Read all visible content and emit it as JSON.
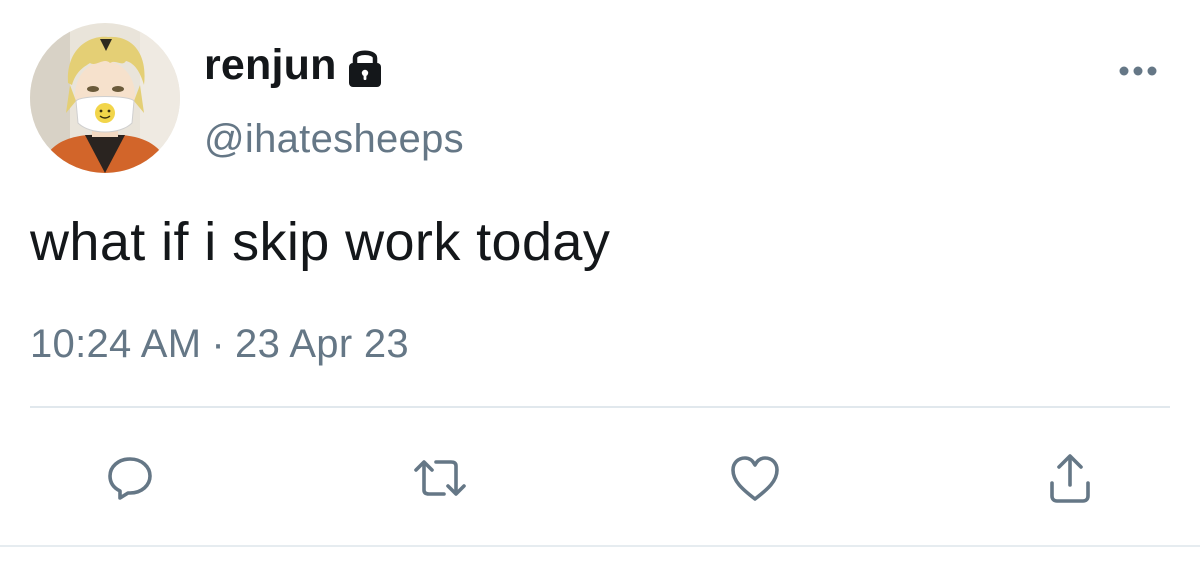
{
  "user": {
    "display_name": "renjun",
    "handle": "@ihatesheeps",
    "protected_icon": "lock-icon",
    "avatar": "avatar-image"
  },
  "tweet": {
    "text": "what if i skip work today",
    "time": "10:24 AM",
    "separator": "·",
    "date": "23 Apr 23"
  },
  "menu": {
    "icon": "more-options-icon"
  },
  "actions": [
    {
      "icon": "reply-icon"
    },
    {
      "icon": "retweet-icon"
    },
    {
      "icon": "like-icon"
    },
    {
      "icon": "share-icon"
    }
  ],
  "colors": {
    "text_primary": "#14171a",
    "text_secondary": "#657786",
    "icon": "#657786",
    "divider": "#e1e8ed"
  }
}
